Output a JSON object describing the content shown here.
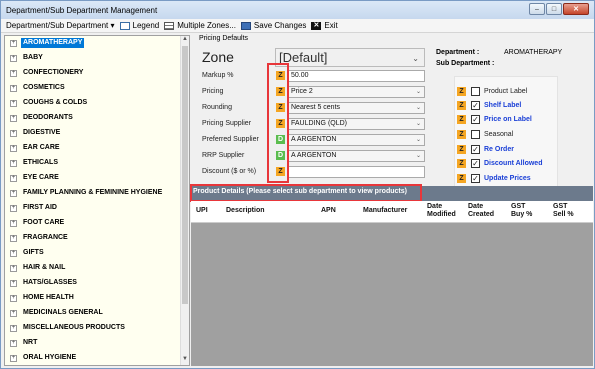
{
  "window": {
    "title": "Department/Sub Department Management",
    "controls": [
      "minimize-icon",
      "maximize-icon",
      "close-icon"
    ]
  },
  "toolbar": {
    "dept_menu": "Department/Sub Department ▾",
    "legend": "Legend",
    "multiple_zones": "Multiple Zones...",
    "save": "Save Changes",
    "exit": "Exit"
  },
  "tree": {
    "items": [
      "AROMATHERAPY",
      "BABY",
      "CONFECTIONERY",
      "COSMETICS",
      "COUGHS & COLDS",
      "DEODORANTS",
      "DIGESTIVE",
      "EAR CARE",
      "ETHICALS",
      "EYE CARE",
      "FAMILY PLANNING & FEMININE HYGIENE",
      "FIRST AID",
      "FOOT CARE",
      "FRAGRANCE",
      "GIFTS",
      "HAIR & NAIL",
      "HATS/GLASSES",
      "HOME HEALTH",
      "MEDICINALS GENERAL",
      "MISCELLANEOUS PRODUCTS",
      "NRT",
      "ORAL HYGIENE"
    ],
    "selected": "AROMATHERAPY"
  },
  "pricing": {
    "section_title": "Pricing Defaults",
    "zone_label": "Zone",
    "zone_value": "[Default]",
    "fields": [
      {
        "label": "Markup %",
        "badge": "Z",
        "value": "50.00"
      },
      {
        "label": "Pricing",
        "badge": "Z",
        "value": "Price 2"
      },
      {
        "label": "Rounding",
        "badge": "Z",
        "value": "Nearest 5 cents"
      },
      {
        "label": "Pricing Supplier",
        "badge": "Z",
        "value": "FAULDING (QLD)"
      },
      {
        "label": "Preferred Supplier",
        "badge": "D",
        "value": "A ARGENTON"
      },
      {
        "label": "RRP Supplier",
        "badge": "D",
        "value": "A ARGENTON"
      },
      {
        "label": "Discount ($ or %)",
        "badge": "Z",
        "value": ""
      }
    ]
  },
  "department": {
    "dept_label": "Department :",
    "dept_value": "AROMATHERAPY",
    "sub_label": "Sub Department :",
    "sub_value": ""
  },
  "options": [
    {
      "label": "Product Label",
      "checked": false,
      "highlight": false
    },
    {
      "label": "Shelf Label",
      "checked": true,
      "highlight": true
    },
    {
      "label": "Price on Label",
      "checked": true,
      "highlight": true
    },
    {
      "label": "Seasonal",
      "checked": false,
      "highlight": false
    },
    {
      "label": "Re Order",
      "checked": true,
      "highlight": true
    },
    {
      "label": "Discount Allowed",
      "checked": true,
      "highlight": true
    },
    {
      "label": "Update Prices",
      "checked": true,
      "highlight": true
    }
  ],
  "product_details": {
    "title": "Product Details (Please select sub department to view products)",
    "columns": [
      "UPI",
      "Description",
      "APN",
      "Manufacturer",
      "Date Modified",
      "Date Created",
      "GST Buy %",
      "GST Sell %"
    ]
  },
  "colors": {
    "selection": "#0078d7",
    "badge_z": "#f5a623",
    "badge_d": "#5bbd4f",
    "highlight_box": "#e8363a",
    "link_blue": "#1a3fd6",
    "grid_header": "#6c7a8c",
    "grid_body": "#a0a0a0"
  }
}
